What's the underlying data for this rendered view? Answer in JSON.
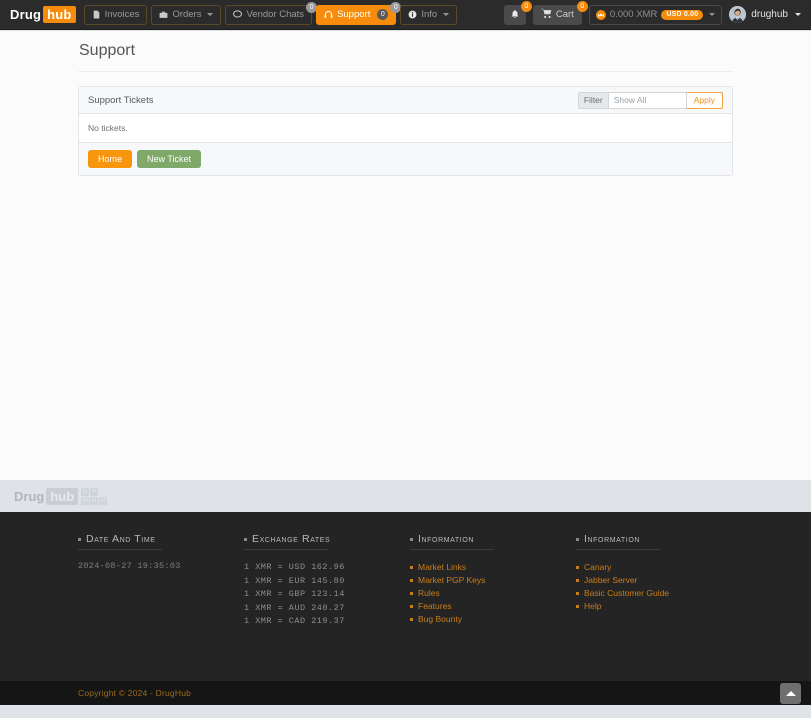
{
  "navbar": {
    "brand": {
      "first": "Drug",
      "second": "hub"
    },
    "items": [
      {
        "label": "Invoices",
        "icon": "file-icon",
        "caret": false,
        "badge": null,
        "active": false
      },
      {
        "label": "Orders",
        "icon": "briefcase-icon",
        "caret": true,
        "badge": null,
        "active": false
      },
      {
        "label": "Vendor Chats",
        "icon": "chat-icon",
        "caret": false,
        "badge": "0",
        "active": false
      },
      {
        "label": "Support",
        "icon": "headset-icon",
        "caret": false,
        "badge": "0",
        "badge_inline": "0",
        "active": true
      },
      {
        "label": "Info",
        "icon": "info-icon",
        "caret": true,
        "badge": null,
        "active": false
      }
    ],
    "notifications": {
      "icon": "bell-icon",
      "badge": "0"
    },
    "cart": {
      "label": "Cart",
      "icon": "cart-icon",
      "badge": "0"
    },
    "balance": {
      "amount": "0.000 XMR",
      "fiat_badge": "USD 0.00",
      "icon": "monero-icon"
    },
    "user": {
      "name": "drughub",
      "avatar": "user-avatar"
    }
  },
  "main": {
    "page_title": "Support",
    "panel": {
      "title": "Support Tickets",
      "filter": {
        "label": "Filter",
        "selected": "Show All",
        "apply_label": "Apply"
      },
      "body_text": "No tickets.",
      "footer_buttons": [
        {
          "label": "Home",
          "style": "orange"
        },
        {
          "label": "New Ticket",
          "style": "green"
        }
      ]
    }
  },
  "footer_logo": {
    "first": "Drug",
    "second": "hub",
    "tiles_top": [
      "D",
      "P"
    ],
    "tiles_bottom": [
      "W",
      "H",
      "M"
    ]
  },
  "footer": {
    "columns": [
      {
        "heading": "Date and Time",
        "type": "text",
        "lines": [
          "2024-08-27 19:35:03"
        ]
      },
      {
        "heading": "Exchange Rates",
        "type": "rates",
        "lines": [
          "1 XMR = USD 162.96",
          "1 XMR = EUR 145.80",
          "1 XMR = GBP 123.14",
          "1 XMR = AUD 240.27",
          "1 XMR = CAD 219.37"
        ]
      },
      {
        "heading": "Information",
        "type": "links",
        "lines": [
          "Market Links",
          "Market PGP Keys",
          "Rules",
          "Features",
          "Bug Bounty"
        ]
      },
      {
        "heading": "Information",
        "type": "links",
        "lines": [
          "Canary",
          "Jabber Server",
          "Basic Customer Guide",
          "Help"
        ]
      }
    ],
    "copyright": "Copyright © 2024 - DrugHub",
    "scroll_top": "scroll-to-top"
  },
  "colors": {
    "accent_orange": "#f78c0c",
    "green_button": "#7fa968",
    "navbar_bg": "#2b2b2b",
    "footer_bg": "#242424",
    "link_orange": "#c87d1a"
  }
}
